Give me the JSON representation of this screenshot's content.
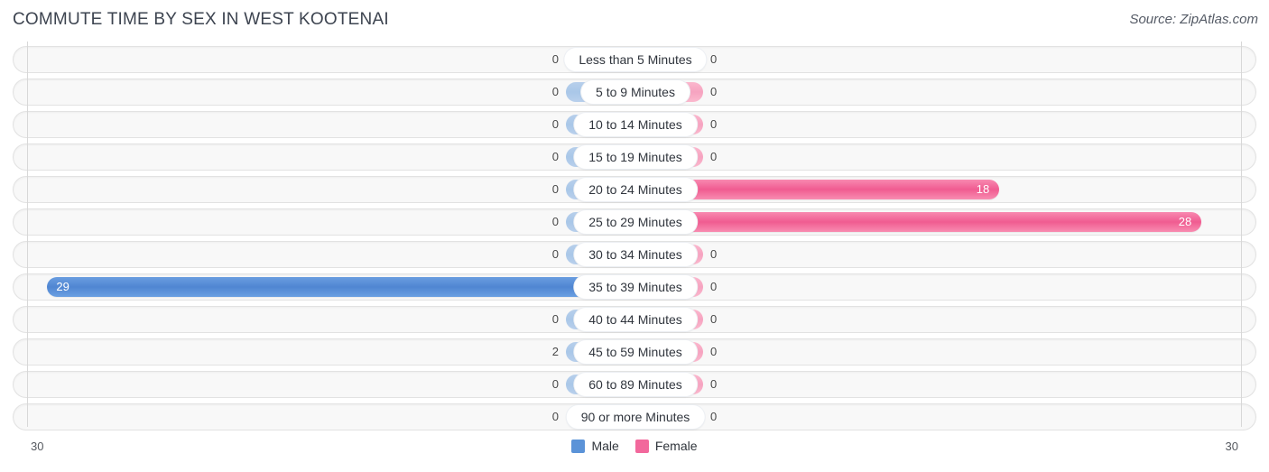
{
  "header": {
    "title": "COMMUTE TIME BY SEX IN WEST KOOTENAI",
    "source": "Source: ZipAtlas.com"
  },
  "legend": {
    "male_label": "Male",
    "female_label": "Female",
    "male_color": "#5b93d8",
    "female_color": "#f2689c"
  },
  "axis": {
    "left_tick": "30",
    "right_tick": "30",
    "max": 30
  },
  "chart_data": {
    "type": "bar",
    "title": "COMMUTE TIME BY SEX IN WEST KOOTENAI",
    "subtitle": "Source: ZipAtlas.com",
    "orientation": "horizontal-diverging",
    "xlabel": "",
    "ylabel": "",
    "xlim": [
      30,
      30
    ],
    "grid": false,
    "legend_position": "bottom-center",
    "categories": [
      "Less than 5 Minutes",
      "5 to 9 Minutes",
      "10 to 14 Minutes",
      "15 to 19 Minutes",
      "20 to 24 Minutes",
      "25 to 29 Minutes",
      "30 to 34 Minutes",
      "35 to 39 Minutes",
      "40 to 44 Minutes",
      "45 to 59 Minutes",
      "60 to 89 Minutes",
      "90 or more Minutes"
    ],
    "series": [
      {
        "name": "Male",
        "color": "#5b93d8",
        "values": [
          0,
          0,
          0,
          0,
          0,
          0,
          0,
          29,
          0,
          2,
          0,
          0
        ]
      },
      {
        "name": "Female",
        "color": "#f2689c",
        "values": [
          0,
          0,
          0,
          0,
          18,
          28,
          0,
          0,
          0,
          0,
          0,
          0
        ]
      }
    ]
  },
  "rows": [
    {
      "label": "Less than 5 Minutes",
      "male": "0",
      "female": "0"
    },
    {
      "label": "5 to 9 Minutes",
      "male": "0",
      "female": "0"
    },
    {
      "label": "10 to 14 Minutes",
      "male": "0",
      "female": "0"
    },
    {
      "label": "15 to 19 Minutes",
      "male": "0",
      "female": "0"
    },
    {
      "label": "20 to 24 Minutes",
      "male": "0",
      "female": "18"
    },
    {
      "label": "25 to 29 Minutes",
      "male": "0",
      "female": "28"
    },
    {
      "label": "30 to 34 Minutes",
      "male": "0",
      "female": "0"
    },
    {
      "label": "35 to 39 Minutes",
      "male": "29",
      "female": "0"
    },
    {
      "label": "40 to 44 Minutes",
      "male": "0",
      "female": "0"
    },
    {
      "label": "45 to 59 Minutes",
      "male": "2",
      "female": "0"
    },
    {
      "label": "60 to 89 Minutes",
      "male": "0",
      "female": "0"
    },
    {
      "label": "90 or more Minutes",
      "male": "0",
      "female": "0"
    }
  ]
}
